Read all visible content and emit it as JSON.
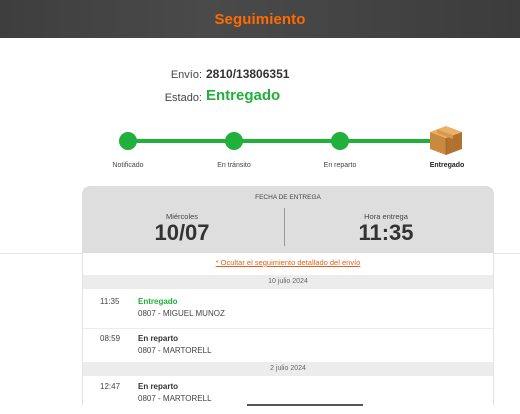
{
  "header": {
    "title": "Seguimiento"
  },
  "shipment": {
    "label": "Envío:",
    "number": "2810/13806351",
    "state_label": "Estado:",
    "state_value": "Entregado",
    "state_color": "#21b03b"
  },
  "progress": {
    "steps": [
      {
        "label": "Notificado",
        "done": true
      },
      {
        "label": "En tránsito",
        "done": true
      },
      {
        "label": "En reparto",
        "done": true
      },
      {
        "label": "Entregado",
        "current": true,
        "icon": "package-box-icon"
      }
    ]
  },
  "delivery": {
    "heading": "FECHA DE ENTREGA",
    "day_label": "Miércoles",
    "date": "10/07",
    "time_label": "Hora entrega",
    "time": "11:35"
  },
  "detail": {
    "toggle_link": "* Ocultar el seguimiento detallado del envío",
    "groups": [
      {
        "date": "10 julio 2024",
        "events": [
          {
            "time": "11:35",
            "status": "Entregado",
            "place": "0807 - MIGUEL MUNOZ",
            "highlight": true
          },
          {
            "time": "08:59",
            "status": "En reparto",
            "place": "0807 - MARTORELL",
            "highlight": false
          }
        ]
      },
      {
        "date": "2 julio 2024",
        "events": [
          {
            "time": "12:47",
            "status": "En reparto",
            "place": "0807 - MARTORELL",
            "highlight": false
          }
        ]
      }
    ]
  },
  "colors": {
    "accent": "#ff6b00",
    "success": "#21b03b",
    "link": "#e85d1a",
    "header_bg": "#404040"
  }
}
